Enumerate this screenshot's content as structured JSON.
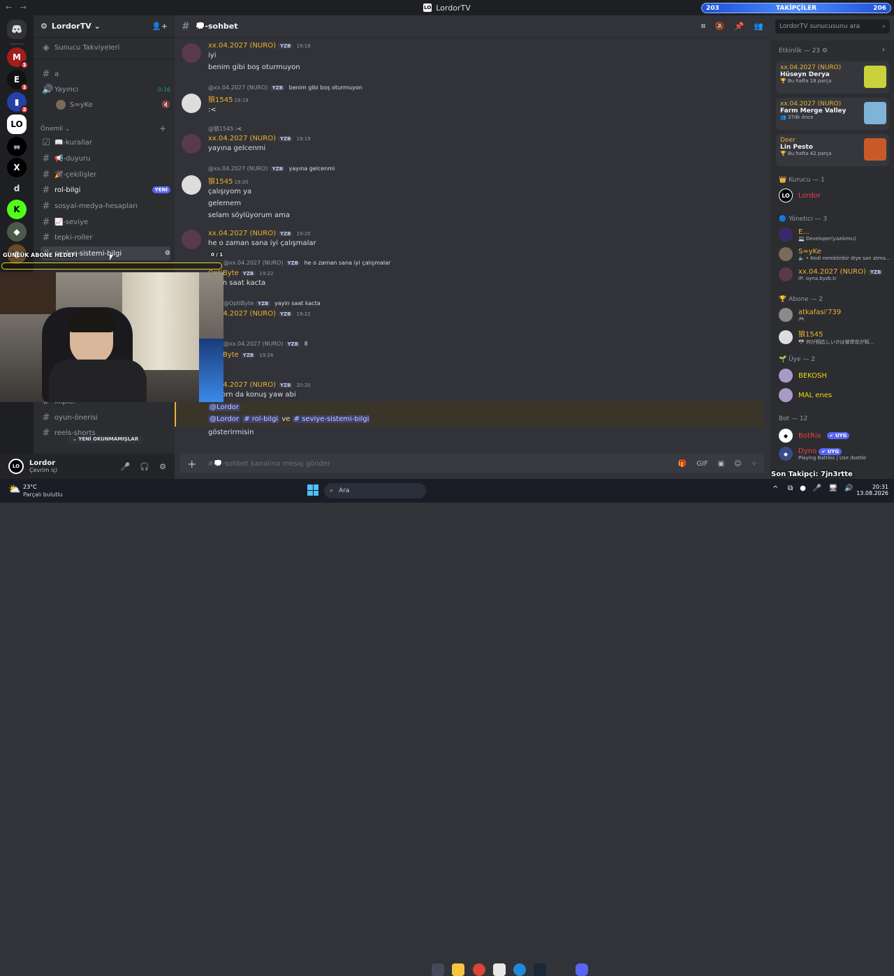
{
  "window": {
    "title": "LordorTV",
    "logo": "LO",
    "nav": "← →"
  },
  "followers_bar": {
    "left": "203",
    "label": "TAKİPÇİLER",
    "right": "206",
    "fill": 0.5
  },
  "servers": {
    "badges": [
      "1",
      "1",
      "2"
    ],
    "letter": "d"
  },
  "guild": {
    "name": "LordorTV ⌄",
    "boost": "Sunucu Takviyeleri"
  },
  "channels": {
    "a": "a",
    "voice": "Yayıncı",
    "voice_time": "0:16",
    "voice_user": "S≈yKe",
    "cat_onemli": "Önemli ⌄",
    "kurallar": "📖-kurallar",
    "duyuru": "📢-duyuru",
    "cekilisler": "🎉-çekilişler",
    "rol_bilgi": "rol-bilgi",
    "rol_new": "YENİ",
    "sosyal": "sosyal-medya-hesapları",
    "seviye": "📈-seviye",
    "tepki": "tepki-roller",
    "seviye_sistemi": "seviye-sistemi-bilgi",
    "klipler": "klipler",
    "oyun": "oyun-önerisi",
    "reels": "reels-shorts",
    "unread": "⌄ YENİ OKUNMAMIŞLAR"
  },
  "user": {
    "name": "Lordor",
    "status": "Çevrim içi"
  },
  "channel_header": {
    "name": "💭-sohbet"
  },
  "search": {
    "placeholder": "LordorTV sunucusunu ara"
  },
  "messages": [
    {
      "user": "xx.04.2027 (NURO)",
      "tag": "YZB",
      "time": "19:18",
      "lines": [
        "iyi",
        "benim gibi boş oturmuyon"
      ]
    },
    {
      "reply_user": "@xx.04.2027 (NURO)",
      "reply_tag": "YZB",
      "reply_text": "benim gibi boş oturmuyon",
      "user": "狼1545",
      "time": "19:19",
      "lines": [
        ":<"
      ]
    },
    {
      "reply_user": "@狼1545",
      "reply_text": ":<",
      "user": "xx.04.2027 (NURO)",
      "tag": "YZB",
      "time": "19:19",
      "lines": [
        "yayına gelcenmi"
      ]
    },
    {
      "reply_user": "@xx.04.2027 (NURO)",
      "reply_tag": "YZB",
      "reply_text": "yayına gelcenmi",
      "user": "狼1545",
      "time": "19:20",
      "lines": [
        "çalışıyom ya",
        "gelemem",
        "selam söylüyorum ama"
      ]
    },
    {
      "user": "xx.04.2027 (NURO)",
      "tag": "YZB",
      "time": "19:20",
      "lines": [
        "he o zaman sana iyi çalışmalar"
      ]
    },
    {
      "reply_user": "@xx.04.2027 (NURO)",
      "reply_tag": "YZB",
      "reply_text": "he o zaman sana iyi çalışmalar",
      "user": "OptiByte",
      "tag": "YZB",
      "time": "19:22",
      "lines": [
        "yayin saat kacta"
      ]
    },
    {
      "reply_user": "@OptiByte",
      "reply_tag": "YZB",
      "reply_text": "yayin saat kacta",
      "user": "xx.04.2027 (NURO)",
      "tag": "YZB",
      "time": "19:22",
      "lines": []
    },
    {
      "reply_user": "@xx.04.2027 (NURO)",
      "reply_tag": "YZB",
      "reply_text": "8",
      "user": "OptiByte",
      "tag": "YZB",
      "time": "19:26",
      "lines": []
    },
    {
      "user": "xx.04.2027 (NURO)",
      "tag": "YZB",
      "time": "20:20",
      "lines": [
        "lordorn da konuş yaw abi"
      ]
    }
  ],
  "highlight": {
    "mention1": "@Lordor",
    "mention2": "@Lordor",
    "ch1": "# rol-bilgi",
    "ve": "ve",
    "ch2": "# seviye-sistemi-bilgi",
    "last": "gösterirmisin"
  },
  "composer": {
    "placeholder": "#💭-sohbet kanalına mesaj gönder"
  },
  "activity": {
    "title": "Etkinlik — 23 ⚙",
    "cards": [
      {
        "user": "xx.04.2027 (NURO)",
        "game": "Hüseyn Derya",
        "sub": "🏆 Bu hafta 18 parça"
      },
      {
        "user": "xx.04.2027 (NURO)",
        "game": "Farm Merge Valley",
        "sub": "👥 37dk önce"
      },
      {
        "user": "Deer",
        "game": "Lin Pesto",
        "sub": "🏆 Bu hafta 42 parça"
      }
    ]
  },
  "members": {
    "kurucu": "👑 Kurucu — 1",
    "lordor": "Lordor",
    "yonetici": "🔵 Yönetici — 3",
    "y1": "E...",
    "y1sub": "💻 Developer(yazılımcı)",
    "y2": "S≈yKe",
    "y2sub": "🔈 • Kedi nerekördür diye san atma...",
    "y3": "xx.04.2027 (NURO)",
    "y3tag": "YZB",
    "y3sub": "IP: oyna.byzb.tr",
    "abone": "🏆 Abone — 2",
    "a1": "atkafasi'739",
    "a1sub": "🎮",
    "a2": "狼1545",
    "a2sub": "🎌 何が相応しいかは彼岸花が知...",
    "uye": "🌱 Üye — 2",
    "u1": "BEKOSH",
    "u2": "MAL enes",
    "bot": "Bot — 12",
    "b1": "BotRix",
    "b1tag": "✔ UYG",
    "b2": "Dyno",
    "b2tag": "✔ UYG",
    "b2sub": "Playing Battles | Use /battle"
  },
  "overlay": {
    "daily": "GÜNLÜK ABONE HEDEFİ",
    "progress": "0 / 1",
    "progress_value": 0,
    "sonfollow": "Son Takipçi: 7jn3rtte"
  },
  "taskbar": {
    "temp": "23°C",
    "weather": "Parçalı bulutlu",
    "search": "Ara",
    "time": "20:31",
    "date": "13.08.2026",
    "chev": "^"
  },
  "colors": {
    "accent": "#5865f2",
    "username": "#f0b232",
    "online": "#23a55a",
    "danger": "#f23f42"
  }
}
